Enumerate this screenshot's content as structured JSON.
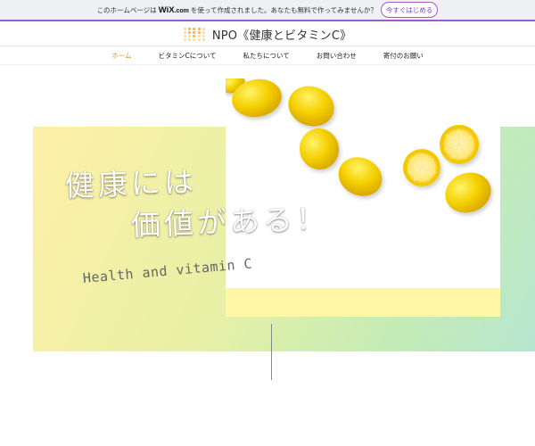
{
  "wix_banner": {
    "prefix": "このホームページは",
    "logo": "WiX",
    "logo_suffix": ".com",
    "suffix": "を使って作成されました。あなたも無料で作ってみませんか？",
    "cta": "今すぐはじめる"
  },
  "header": {
    "title": "NPO《健康とビタミンC》",
    "logo_icon": "dot-grid-icon"
  },
  "nav": {
    "items": [
      "ホーム",
      "ビタミンCについて",
      "私たちについて",
      "お問い合わせ",
      "寄付のお願い"
    ],
    "active": "ホーム"
  },
  "hero": {
    "heading_line1": "健康には",
    "heading_line2": "価値がある！",
    "subheading": "Health and vitamin C",
    "image": "lemons-photo"
  },
  "colors": {
    "accent": "#e0902a",
    "wix_purple": "#9b5ec7",
    "lemon": "#f5d400",
    "band_start": "#fff0a8",
    "band_end": "#b6e6cf"
  }
}
